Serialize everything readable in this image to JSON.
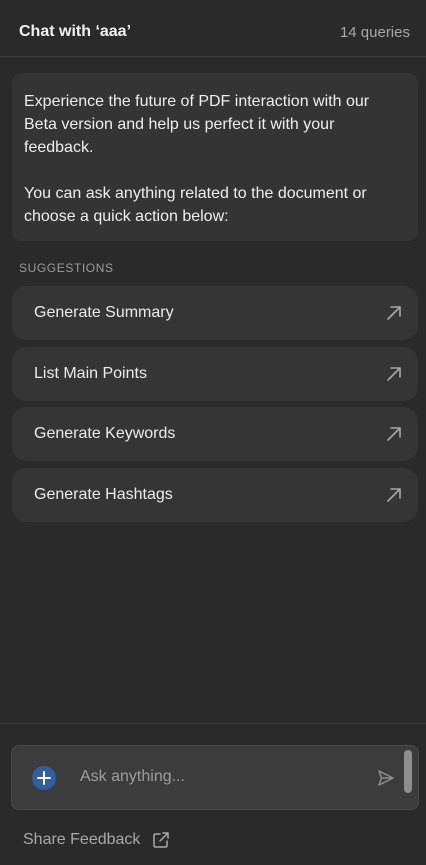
{
  "header": {
    "title": "Chat with ‘aaa’",
    "query_count": "14 queries"
  },
  "intro": {
    "paragraph1": "Experience the future of PDF interaction with our Beta version and help us perfect it with your feedback.",
    "paragraph2": "You can ask anything related to the document or choose a quick action below:"
  },
  "suggestions": {
    "section_label": "SUGGESTIONS",
    "items": [
      {
        "label": "Generate Summary",
        "icon": "arrow-up-right-icon"
      },
      {
        "label": "List Main Points",
        "icon": "arrow-up-right-icon"
      },
      {
        "label": "Generate Keywords",
        "icon": "arrow-up-right-icon"
      },
      {
        "label": "Generate Hashtags",
        "icon": "arrow-up-right-icon"
      }
    ]
  },
  "composer": {
    "placeholder": "Ask anything...",
    "value": "",
    "add_icon": "plus-icon",
    "send_icon": "send-icon"
  },
  "footer": {
    "share_feedback_label": "Share Feedback",
    "share_icon": "external-link-icon"
  },
  "colors": {
    "background": "#2a2a2a",
    "card": "#353535",
    "accent_blue": "#2f5fa0"
  }
}
